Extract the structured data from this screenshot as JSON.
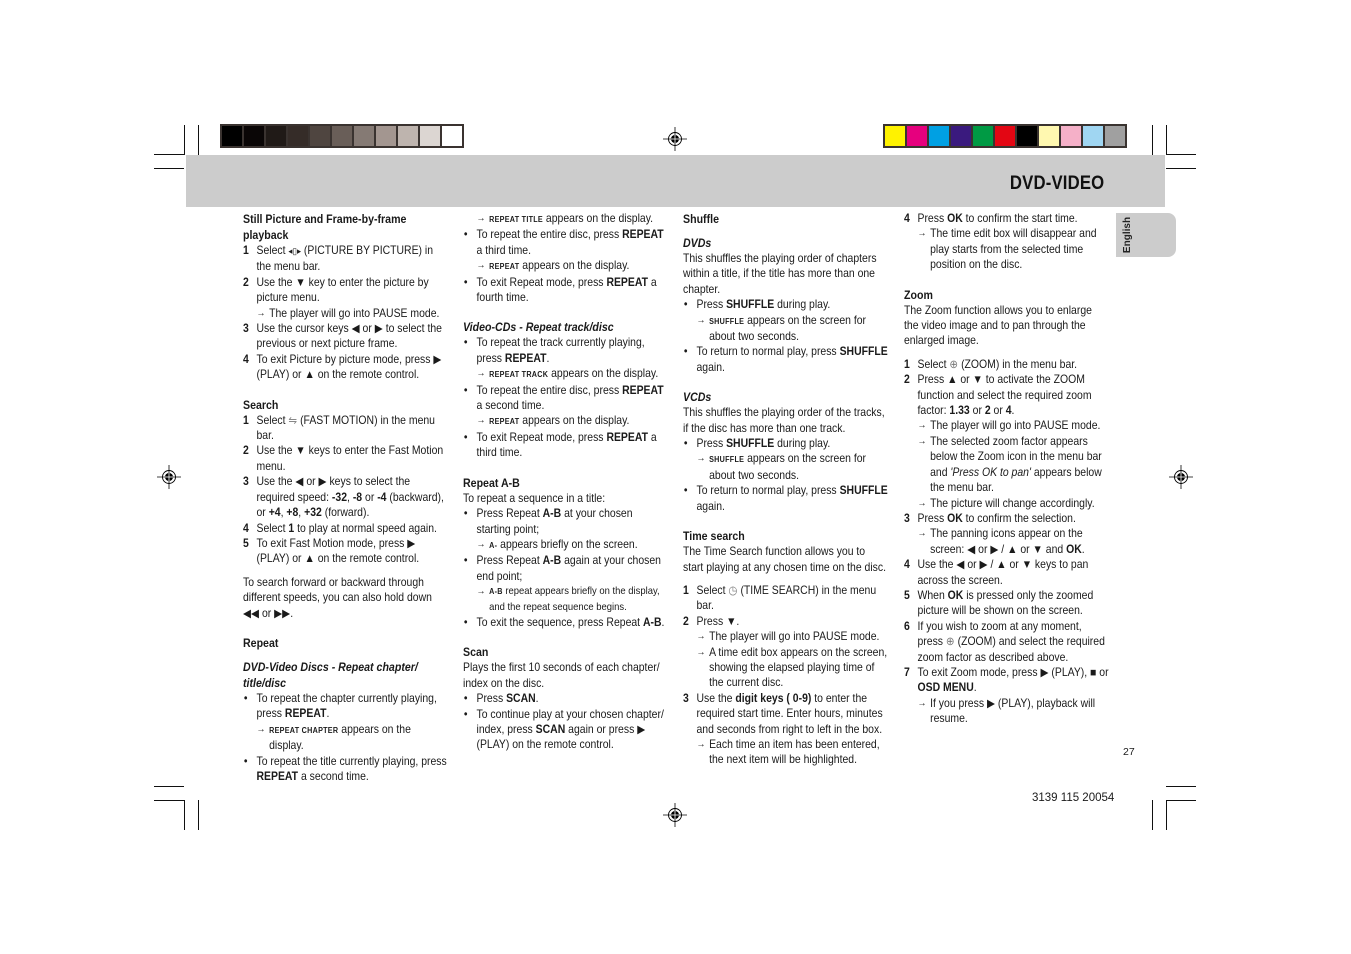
{
  "header": {
    "title": "DVD-VIDEO",
    "language_tab": "English"
  },
  "color_bars": {
    "grayscale": [
      "#000000",
      "#0a0606",
      "#201a17",
      "#352c28",
      "#4f4540",
      "#695e58",
      "#857a74",
      "#a39690",
      "#beb4ae",
      "#dcd6d2",
      "#ffffff"
    ],
    "color": [
      "#fff200",
      "#e6007e",
      "#00a0e3",
      "#3a1a7e",
      "#009a44",
      "#e30613",
      "#000000",
      "#fff8b0",
      "#f5b0c8",
      "#a0d6f2",
      "#a0a0a0"
    ]
  },
  "col1": {
    "still": {
      "heading": "Still Picture and Frame-by-frame playback",
      "s1n": "1",
      "s1a": "Select",
      "s1b": "(PICTURE BY PICTURE) in the menu bar.",
      "s2n": "2",
      "s2a": "Use the",
      "s2b": "key to enter the picture by picture menu.",
      "s2r": "The player will go into PAUSE mode.",
      "s3n": "3",
      "s3a": "Use the cursor keys",
      "s3b": "or",
      "s3c": "to select the previous or next picture frame.",
      "s4n": "4",
      "s4a": "To exit Picture by picture mode, press",
      "s4b": "(PLAY) or",
      "s4c": "on the remote control."
    },
    "search": {
      "heading": "Search",
      "s1n": "1",
      "s1a": "Select",
      "s1b": "(FAST MOTION) in the menu bar.",
      "s2n": "2",
      "s2a": "Use the",
      "s2b": "keys to enter the Fast Motion menu.",
      "s3n": "3",
      "s3a": "Use the",
      "s3b": "or",
      "s3c": "keys to select the required speed:",
      "sp1": "-32",
      "sp2": "-8",
      "sp3": "-4",
      "or": "or",
      "backward": "(backward), or",
      "sp4": "+4",
      "sp5": "+8",
      "sp6": "+32",
      "forward": "(forward).",
      "s4n": "4",
      "s4a": "Select",
      "s4b": "1",
      "s4c": "to play at normal speed again.",
      "s5n": "5",
      "s5a": "To exit Fast Motion mode, press",
      "s5b": "(PLAY) or",
      "s5c": "on the remote control.",
      "note": "To search forward or backward through different speeds, you can also hold down",
      "note_or": "or"
    },
    "repeat": {
      "heading": "Repeat",
      "sub": "DVD-Video Discs - Repeat chapter/ title/disc",
      "b1a": "To repeat the chapter currently playing, press",
      "b1b": "REPEAT",
      "b1r_code": "REPEAT CHAPTER",
      "b1r": "appears on the display.",
      "b2a": "To repeat the title currently playing, press",
      "b2b": "REPEAT",
      "b2c": "a second time."
    }
  },
  "col2": {
    "r1_code": "REPEAT TITLE",
    "r1": "appears on the display.",
    "b3a": "To repeat the entire disc, press",
    "b3b": "REPEAT",
    "b3c": "a third time.",
    "r3_code": "REPEAT",
    "r3": "appears on the display.",
    "b4a": "To exit Repeat mode, press",
    "b4b": "REPEAT",
    "b4c": "a fourth time.",
    "vcd": {
      "sub": "Video-CDs - Repeat track/disc",
      "b1a": "To repeat the track currently playing, press",
      "b1b": "REPEAT",
      "r1_code": "REPEAT TRACK",
      "r1": "appears on the display.",
      "b2a": "To repeat the entire disc, press",
      "b2b": "REPEAT",
      "b2c": "a second time.",
      "r2_code": "REPEAT",
      "r2": "appears on the display.",
      "b3a": "To exit Repeat mode, press",
      "b3b": "REPEAT",
      "b3c": "a third time."
    },
    "ab": {
      "heading": "Repeat A-B",
      "intro": "To repeat a sequence in a title:",
      "b1a": "Press Repeat",
      "b1b": "A-B",
      "b1c": "at your chosen starting point;",
      "r1_code": "A-",
      "r1": "appears briefly on the screen.",
      "b2a": "Press Repeat",
      "b2b": "A-B",
      "b2c": "again at your chosen end point;",
      "r2_code": "A-B",
      "r2": "repeat appears briefly on the display, and the repeat sequence begins.",
      "b3a": "To exit the sequence, press Repeat",
      "b3b": "A-B",
      "b3c": "."
    },
    "scan": {
      "heading": "Scan",
      "intro": "Plays the first 10 seconds of each chapter/ index on the disc.",
      "b1a": "Press",
      "b1b": "SCAN",
      "b1c": ".",
      "b2a": "To continue play at your chosen chapter/ index, press",
      "b2b": "SCAN",
      "b2c": "again or press",
      "b2d": "(PLAY) on the remote control."
    }
  },
  "col3": {
    "shuffle": {
      "heading": "Shuffle",
      "dvd_sub": "DVDs",
      "dvd_intro": "This shuffles the playing order of chapters within a title, if the title has more than one chapter.",
      "b1a": "Press",
      "b1b": "SHUFFLE",
      "b1c": "during play.",
      "r1_code": "SHUFFLE",
      "r1": "appears on the screen for about two seconds.",
      "b2a": "To return to normal play, press",
      "b2b": "SHUFFLE",
      "b2c": "again.",
      "vcd_sub": "VCDs",
      "vcd_intro": "This shuffles the playing order of the tracks, if the disc has more than one track.",
      "v1a": "Press",
      "v1b": "SHUFFLE",
      "v1c": "during play.",
      "vr1_code": "SHUFFLE",
      "vr1": "appears on the screen for about two seconds.",
      "v2a": "To return to normal play, press",
      "v2b": "SHUFFLE",
      "v2c": "again."
    },
    "time": {
      "heading": "Time search",
      "intro": "The Time Search function allows you to start playing at any chosen time on the disc.",
      "s1n": "1",
      "s1a": "Select",
      "s1b": "(TIME SEARCH) in the menu bar.",
      "s2n": "2",
      "s2a": "Press",
      "s2b": ".",
      "s2r1": "The player will go into PAUSE mode.",
      "s2r2": "A time edit box appears on the screen, showing the elapsed playing time of the current disc.",
      "s3n": "3",
      "s3a": "Use the",
      "s3b": "digit keys ( 0-9)",
      "s3c": "to enter the required start time. Enter hours, minutes and seconds from right to left in the box.",
      "s3r": "Each time an item has been entered, the next item will be highlighted."
    }
  },
  "col4": {
    "s4n": "4",
    "s4a": "Press",
    "s4b": "OK",
    "s4c": "to confirm the start time.",
    "s4r": "The time edit box will disappear and play starts from the selected time position on the disc.",
    "zoom": {
      "heading": "Zoom",
      "intro": "The Zoom function allows you to enlarge the video image and to pan through the enlarged image.",
      "s1n": "1",
      "s1a": "Select",
      "s1b": "(ZOOM) in the menu bar.",
      "s2n": "2",
      "s2a": "Press",
      "s2b": "or",
      "s2c": "to activate the ZOOM function and select the required zoom factor:",
      "f1": "1.33",
      "f2": "2",
      "f3": "4",
      "or": "or",
      "s2r1": "The player will go into PAUSE mode.",
      "s2r2a": "The selected zoom factor appears below the Zoom icon in the menu bar and",
      "s2r2b": "'Press OK to pan'",
      "s2r2c": "appears below the menu bar.",
      "s2r3": "The picture will change accordingly.",
      "s3n": "3",
      "s3a": "Press",
      "s3b": "OK",
      "s3c": "to confirm the selection.",
      "s3r_a": "The panning icons appear on the screen:",
      "s3r_or": "or",
      "s3r_and": "and",
      "s3r_ok": "OK",
      "s4n": "4",
      "s4a": "Use the",
      "s4b": "or",
      "s4c": "keys to pan across the screen.",
      "s5n": "5",
      "s5a": "When",
      "s5b": "OK",
      "s5c": "is pressed only the zoomed picture will be shown on the screen.",
      "s6n": "6",
      "s6a": "If you wish to zoom at any moment, press",
      "s6b": "(ZOOM) and select the required zoom factor as described above.",
      "s7n": "7",
      "s7a": "To exit Zoom mode, press",
      "s7b": "(PLAY),",
      "s7c": "or",
      "s7d": "OSD MENU",
      "s7r_a": "If you press",
      "s7r_b": "(PLAY), playback will resume."
    }
  },
  "footer": {
    "page_number": "27",
    "doc_code": "3139 115 20054"
  }
}
